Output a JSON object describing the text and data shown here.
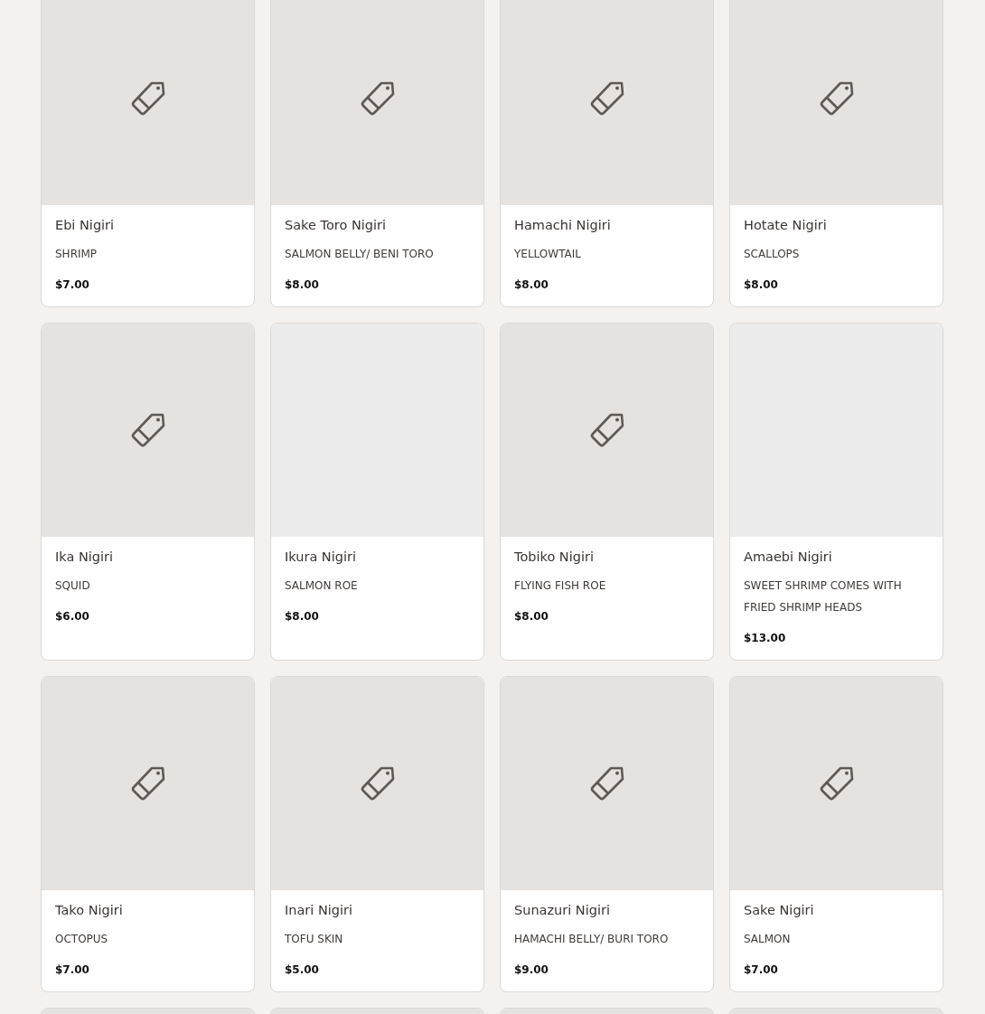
{
  "cards": [
    {
      "kind": "tag",
      "name": "Ebi Nigiri",
      "description": "SHRIMP",
      "price": "$7.00"
    },
    {
      "kind": "tag",
      "name": "Sake Toro Nigiri",
      "description": "SALMON BELLY/ BENI TORO",
      "price": "$8.00"
    },
    {
      "kind": "tag",
      "name": "Hamachi Nigiri",
      "description": "YELLOWTAIL",
      "price": "$8.00"
    },
    {
      "kind": "tag",
      "name": "Hotate Nigiri",
      "description": "SCALLOPS",
      "price": "$8.00"
    },
    {
      "kind": "tag",
      "name": "Ika Nigiri",
      "description": "SQUID",
      "price": "$6.00"
    },
    {
      "kind": "empty",
      "name": "Ikura Nigiri",
      "description": "SALMON ROE",
      "price": "$8.00"
    },
    {
      "kind": "tag",
      "name": "Tobiko Nigiri",
      "description": "FLYING FISH ROE",
      "price": "$8.00"
    },
    {
      "kind": "empty",
      "name": "Amaebi Nigiri",
      "description": "SWEET SHRIMP COMES WITH FRIED SHRIMP HEADS",
      "price": "$13.00"
    },
    {
      "kind": "tag",
      "name": "Tako Nigiri",
      "description": "OCTOPUS",
      "price": "$7.00"
    },
    {
      "kind": "tag",
      "name": "Inari Nigiri",
      "description": "TOFU SKIN",
      "price": "$5.00"
    },
    {
      "kind": "tag",
      "name": "Sunazuri Nigiri",
      "description": "HAMACHI BELLY/ BURI TORO",
      "price": "$9.00"
    },
    {
      "kind": "tag",
      "name": "Sake Nigiri",
      "description": "SALMON",
      "price": "$7.00"
    },
    {
      "kind": "tag"
    },
    {
      "kind": "tag"
    },
    {
      "kind": "tag"
    },
    {
      "kind": "tag"
    }
  ]
}
